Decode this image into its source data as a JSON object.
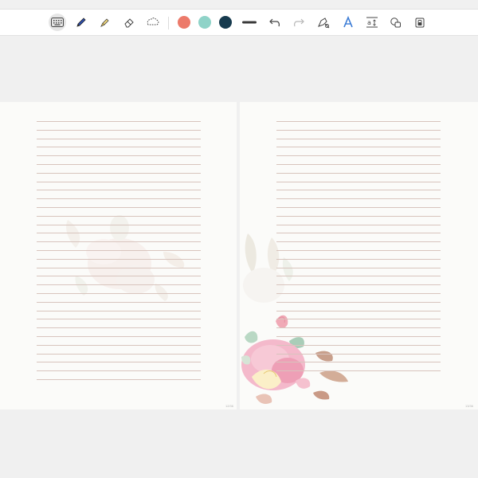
{
  "toolbar": {
    "tools": [
      {
        "name": "keyboard-icon",
        "selected": true
      },
      {
        "name": "pen-icon"
      },
      {
        "name": "highlighter-icon"
      },
      {
        "name": "eraser-icon"
      },
      {
        "name": "lasso-icon"
      }
    ],
    "colors": [
      "#ec7a6a",
      "#8fd3c8",
      "#163a4e"
    ],
    "stroke_color": "#3a3a3a",
    "actions": [
      {
        "name": "undo-icon"
      },
      {
        "name": "redo-icon",
        "disabled": true
      },
      {
        "name": "shape-pen-icon"
      },
      {
        "name": "text-style-icon"
      },
      {
        "name": "text-resize-icon"
      },
      {
        "name": "shapes-icon"
      },
      {
        "name": "lock-icon"
      }
    ]
  },
  "pages": {
    "left": {
      "line_count": 31,
      "page_number": "12/36"
    },
    "right": {
      "line_count": 30,
      "page_number": "13/36"
    }
  }
}
